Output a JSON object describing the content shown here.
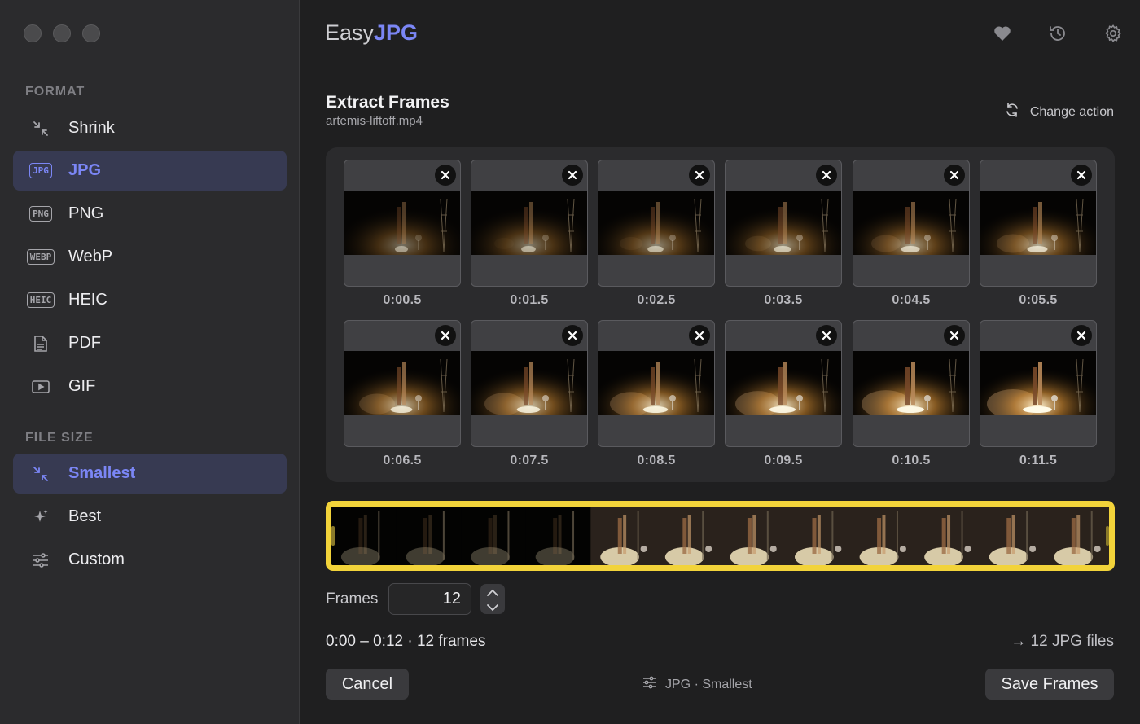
{
  "sidebar": {
    "format_title": "FORMAT",
    "format_items": [
      {
        "label": "Shrink",
        "icon": "shrink-icon"
      },
      {
        "label": "JPG",
        "icon": "jpg-badge-icon",
        "badge": "JPG",
        "active": true
      },
      {
        "label": "PNG",
        "icon": "png-badge-icon",
        "badge": "PNG"
      },
      {
        "label": "WebP",
        "icon": "webp-badge-icon",
        "badge": "WEBP"
      },
      {
        "label": "HEIC",
        "icon": "heic-badge-icon",
        "badge": "HEIC"
      },
      {
        "label": "PDF",
        "icon": "document-icon"
      },
      {
        "label": "GIF",
        "icon": "play-box-icon"
      }
    ],
    "size_title": "FILE SIZE",
    "size_items": [
      {
        "label": "Smallest",
        "icon": "shrink-icon",
        "active": true
      },
      {
        "label": "Best",
        "icon": "sparkle-icon"
      },
      {
        "label": "Custom",
        "icon": "sliders-icon"
      }
    ]
  },
  "header": {
    "brand_part1": "Easy",
    "brand_part2": "JPG",
    "icons": [
      "heart-icon",
      "history-icon",
      "gear-icon"
    ]
  },
  "task": {
    "title": "Extract Frames",
    "filename": "artemis-liftoff.mp4",
    "change_action": "Change action"
  },
  "frames": [
    {
      "time": "0:00.5"
    },
    {
      "time": "0:01.5"
    },
    {
      "time": "0:02.5"
    },
    {
      "time": "0:03.5"
    },
    {
      "time": "0:04.5"
    },
    {
      "time": "0:05.5"
    },
    {
      "time": "0:06.5"
    },
    {
      "time": "0:07.5"
    },
    {
      "time": "0:08.5"
    },
    {
      "time": "0:09.5"
    },
    {
      "time": "0:10.5"
    },
    {
      "time": "0:11.5"
    }
  ],
  "controls": {
    "frames_label": "Frames",
    "frames_value": "12",
    "range_text": "0:00 – 0:12 · 12 frames",
    "output_text": "→ 12 JPG files"
  },
  "footer": {
    "cancel_label": "Cancel",
    "settings_summary": "JPG · Smallest",
    "save_label": "Save Frames"
  },
  "colors": {
    "accent": "#7b86f5",
    "trim_highlight": "#f2d33a",
    "active_bg": "#373a52"
  }
}
